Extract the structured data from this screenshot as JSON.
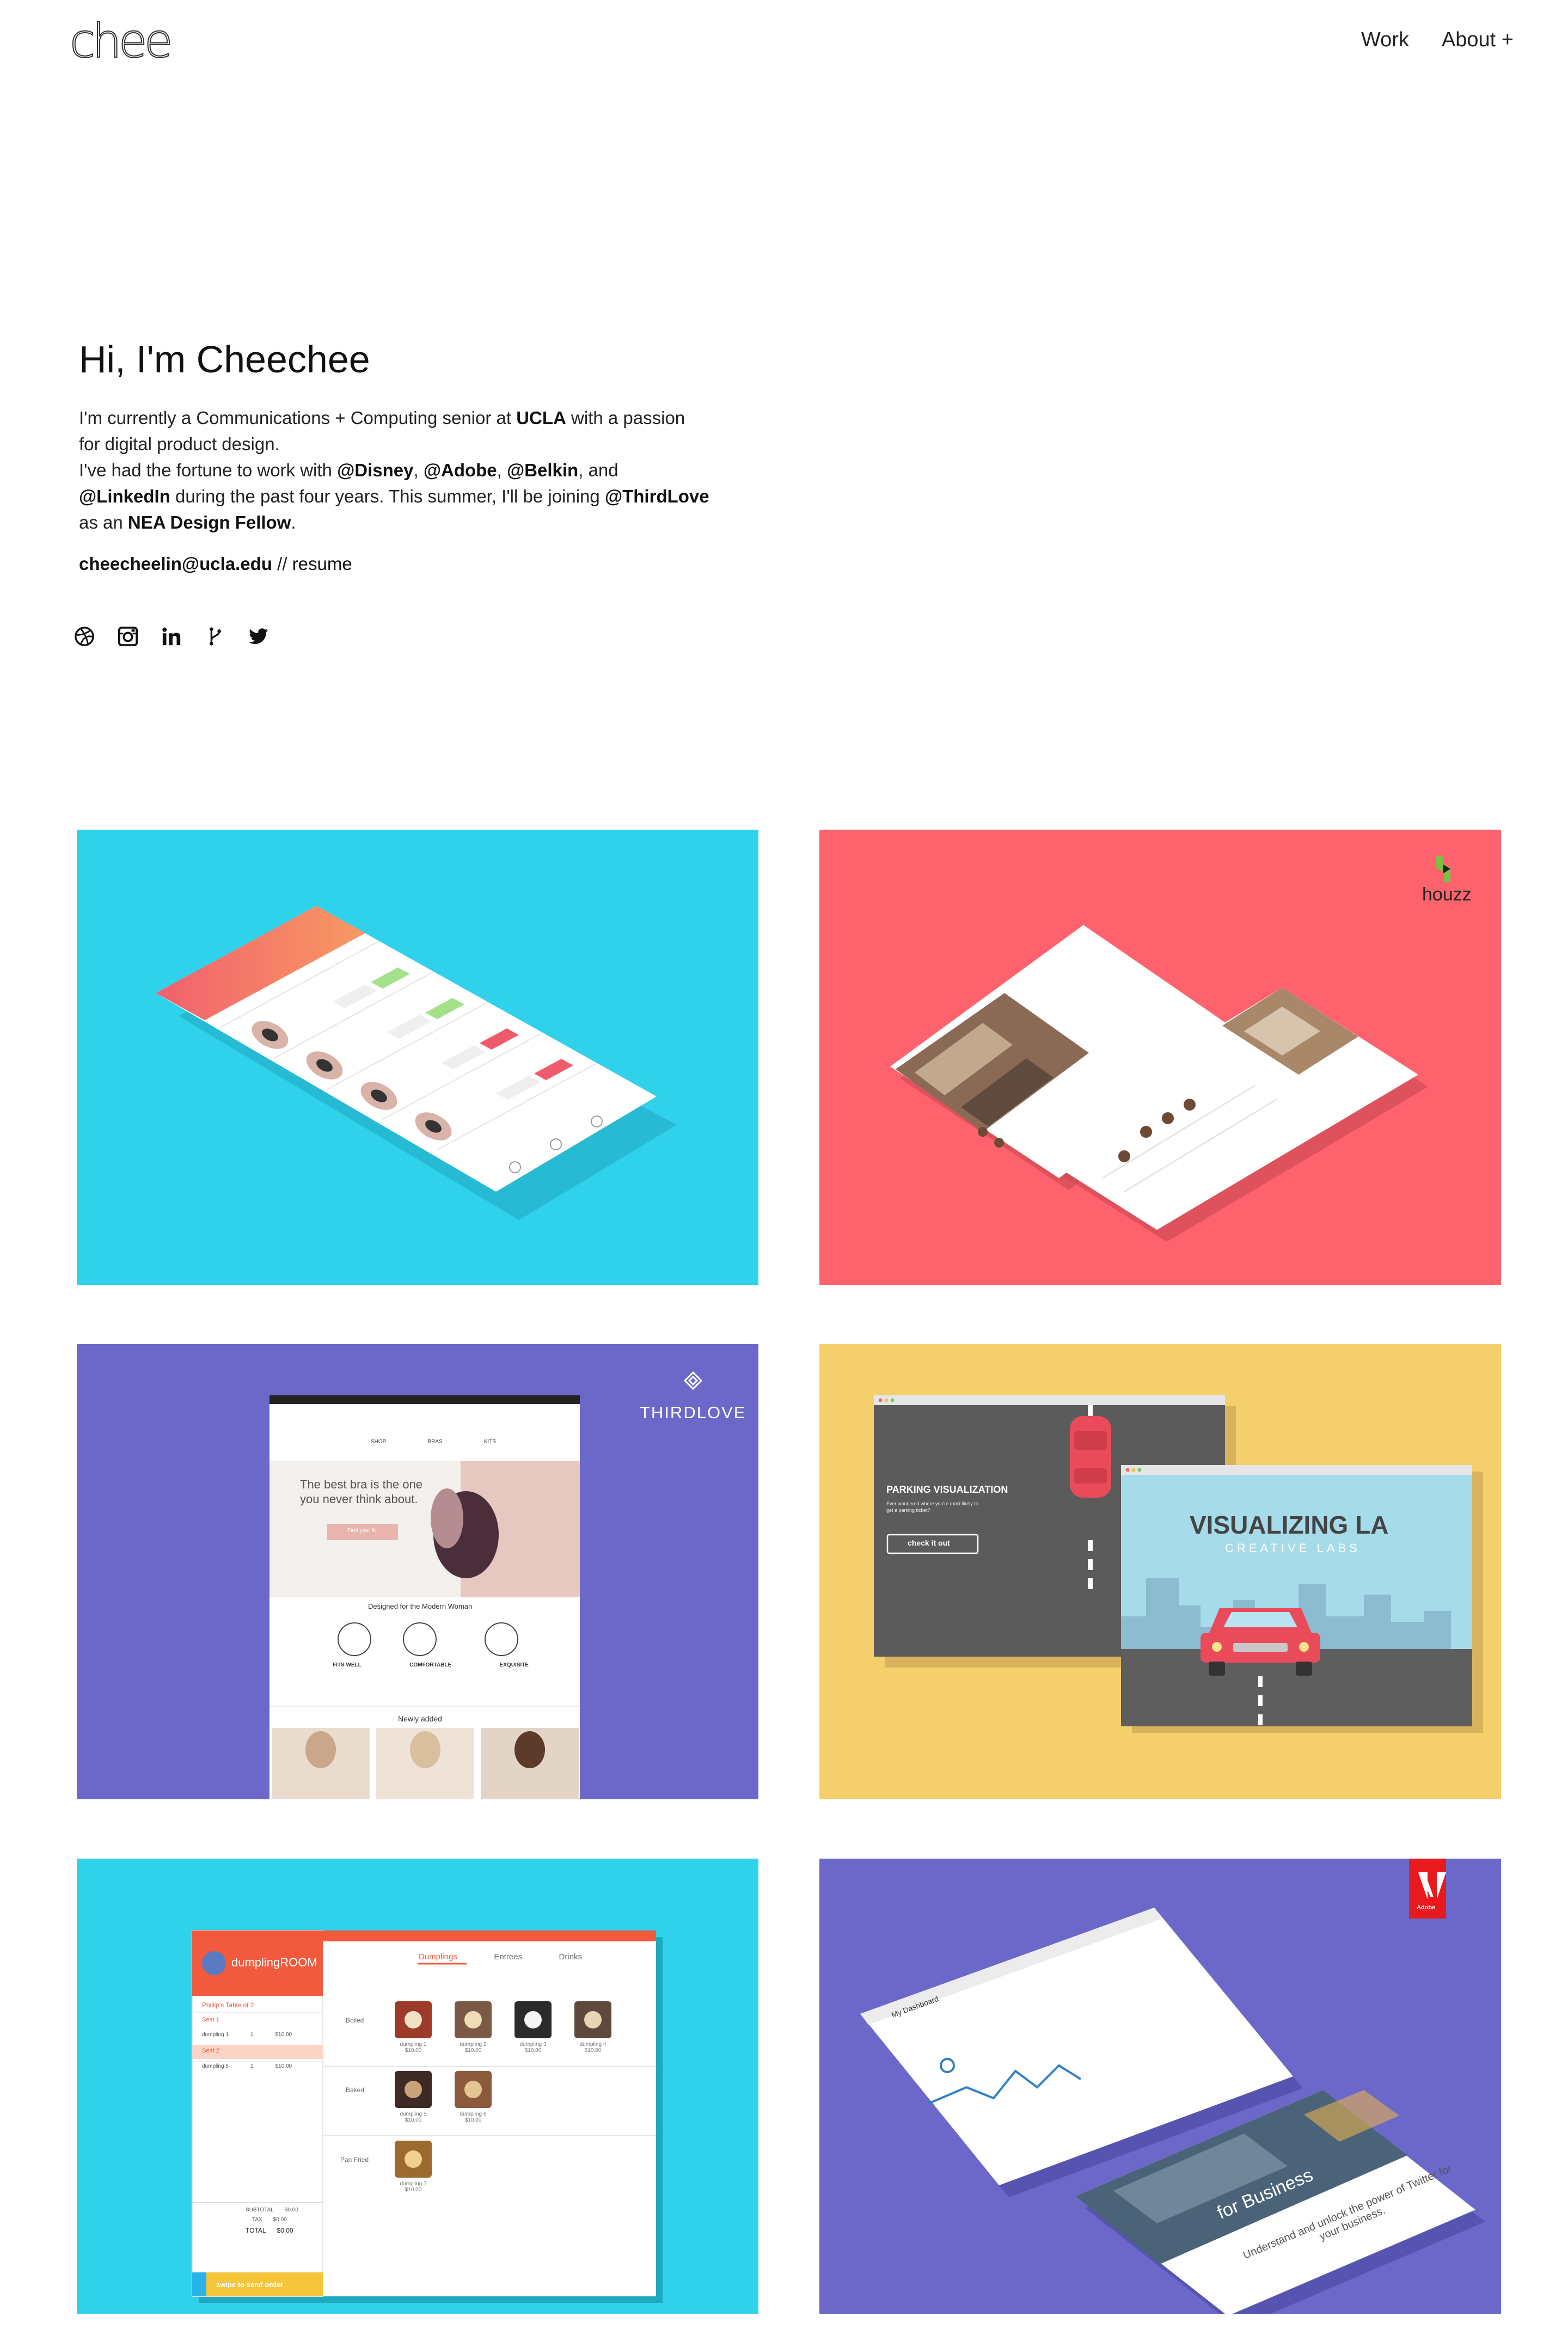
{
  "header": {
    "logo_text": "chee",
    "nav": [
      {
        "label": "Work"
      },
      {
        "label": "About +"
      }
    ]
  },
  "intro": {
    "heading": "Hi, I'm Cheechee",
    "p1_a": "I'm currently a Communications + Computing senior at ",
    "p1_ucla": "UCLA",
    "p1_b": " with a passion for digital product design.",
    "p2_a": "I've had the fortune to work with ",
    "disney": "@Disney",
    "comma1": ", ",
    "adobe": "@Adobe",
    "comma2": ", ",
    "belkin": "@Belkin",
    "and": ", and ",
    "linkedin": "@LinkedIn",
    "p2_b": " during the past four years. This summer, I'll be joining ",
    "thirdlove": "@ThirdLove",
    "p2_c": " as an ",
    "nea": "NEA Design Fellow",
    "period": ".",
    "email": "cheecheelin@ucla.edu",
    "sep": " // ",
    "resume": "resume"
  },
  "social": [
    {
      "icon": "dribbble-icon"
    },
    {
      "icon": "instagram-icon"
    },
    {
      "icon": "linkedin-icon"
    },
    {
      "icon": "github-icon"
    },
    {
      "icon": "twitter-icon"
    }
  ],
  "projects": {
    "colors": {
      "cyan": "#30d1ea",
      "coral": "#fe636d",
      "purple": "#6b68ca",
      "yellow": "#f5cf6c"
    },
    "houzz": {
      "brand": "houzz"
    },
    "thirdlove": {
      "brand": "THIRDLOVE",
      "hero_text_1": "The best bra is the one",
      "hero_text_2": "you never think about.",
      "cta": "Find your fit",
      "designed_for": "Designed for the Modern Woman",
      "features": [
        "FITS WELL",
        "COMFORTABLE",
        "EXQUISITE"
      ],
      "newly": "Newly added",
      "nav_items": [
        "SHOP",
        "BRAS",
        "KITS"
      ]
    },
    "visualizing": {
      "parking_title": "PARKING VISUALIZATION",
      "parking_sub1": "Ever wondered where you're most likely to",
      "parking_sub2": "get a parking ticket?",
      "cta": "check it out",
      "big_title": "VISUALIZING LA",
      "sub": "CREATIVE LABS"
    },
    "dumpling": {
      "brand": "dumplingROOM",
      "tabs": [
        "Dumplings",
        "Entrees",
        "Drinks"
      ],
      "table_title": "Phillip's Table of 2",
      "seat1": "Seat 1",
      "seat2": "Seat 2",
      "order1_name": "dumpling 1",
      "order1_qty": "1",
      "order1_price": "$10.00",
      "order2_name": "dumpling 5",
      "order2_qty": "1",
      "order2_price": "$10.00",
      "sections": [
        "Boiled",
        "Baked",
        "Pan Fried"
      ],
      "items": [
        {
          "name": "dumpling 1",
          "price": "$10.00"
        },
        {
          "name": "dumpling 2",
          "price": "$10.00"
        },
        {
          "name": "dumpling 3",
          "price": "$10.00"
        },
        {
          "name": "dumpling 4",
          "price": "$10.00"
        },
        {
          "name": "dumpling 5",
          "price": "$10.00"
        },
        {
          "name": "dumpling 6",
          "price": "$10.00"
        },
        {
          "name": "dumpling 7",
          "price": "$10.00"
        }
      ],
      "subtotal_label": "SUBTOTAL",
      "subtotal": "$0.00",
      "tax_label": "TAX",
      "tax": "$0.00",
      "total_label": "TOTAL",
      "total": "$0.00",
      "swipe": "swipe to send order"
    },
    "adobe": {
      "logo": "Adobe",
      "dashboard": "My Dashboard",
      "for_business": "for Business",
      "tagline_1": "Understand and unlock the power of Twitter for",
      "tagline_2": "your business."
    }
  }
}
